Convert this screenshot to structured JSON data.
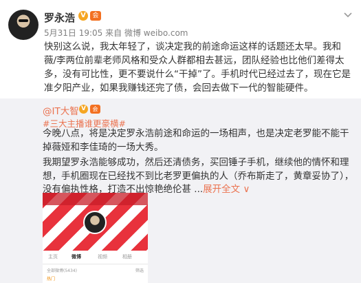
{
  "post": {
    "username": "罗永浩",
    "badge_v": "V",
    "badge_vip": "会",
    "date": "5月31日 19:05",
    "source": "来自 微博 weibo.com",
    "text": "快别这么说，我太年轻了，谈决定我的前途命运这样的话题还太早。我和薇/李两位前辈老师风格和受众人群都相去甚远，团队经验也比他们差得太多，没有可比性，更不要说什么“干掉”了。手机时代已经过去了，现在它是准夕阳产业，如果我赚钱还完了债，会回去做下一代的智能硬件。",
    "menu_icon": "chevron-down-icon"
  },
  "repost": {
    "user": "@IT大智",
    "badge_v": "V",
    "badge_vip": "会",
    "topic": "#三大主播谁更豪横#",
    "paragraph1": "今晚八点，将是决定罗永浩前途和命运的一场相声，也是决定老罗能不能干掉薇娅和李佳琦的一场大秀。",
    "paragraph2": "我期望罗永浩能够成功，然后还清债务，买回锤子手机，继续他的情怀和理想，手机圈现在已经找不到比老罗更偏执的人（乔布斯走了，黄章妥协了），没有偏执性格，打造不出惊艳绝伦甚 ...",
    "expand": "展开全文 ∨",
    "image": {
      "tabs": [
        "主页",
        "微博",
        "视频",
        "相册"
      ],
      "row_left": "全部微博(5434)",
      "row_right": "筛选",
      "row2": "热门"
    }
  }
}
